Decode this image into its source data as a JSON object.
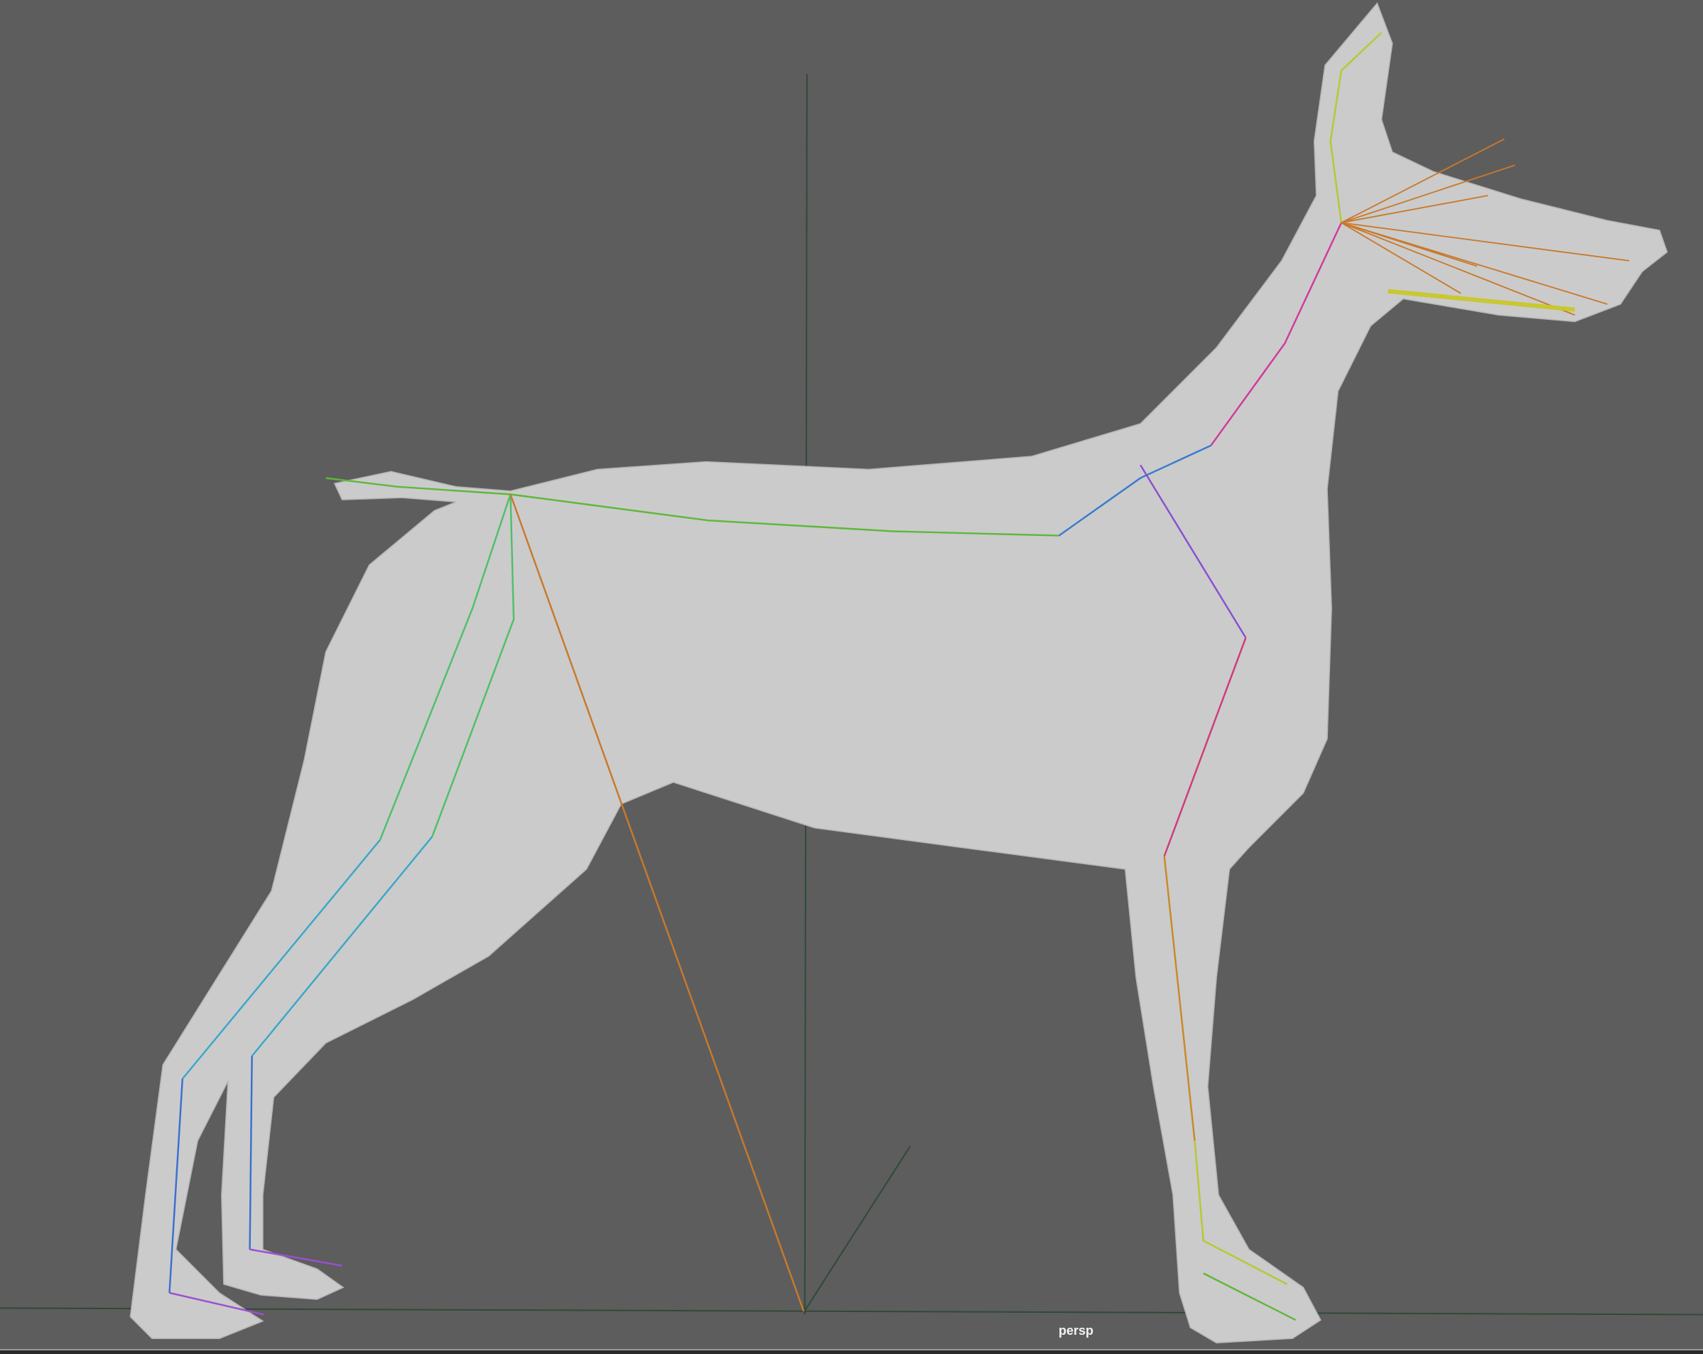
{
  "viewport": {
    "camera_label": "persp",
    "background_color": "#5d5d5d",
    "grid_axis_color": "#2f4a36",
    "model_color": "#c8c8c8"
  },
  "skeleton_colors": {
    "spine": "#5fb83a",
    "hind_leg_upper": "#4fbf6a",
    "hind_leg_lower": "#3aa7c9",
    "hind_paw": "#3b6fd0",
    "toe": "#9b4fd0",
    "front_leg_upper": "#8a4fd0",
    "front_leg_mid": "#d03a7a",
    "front_leg_lower": "#c9892a",
    "head": "#c9792a",
    "face": "#c8c832",
    "root": "#c9792a"
  }
}
